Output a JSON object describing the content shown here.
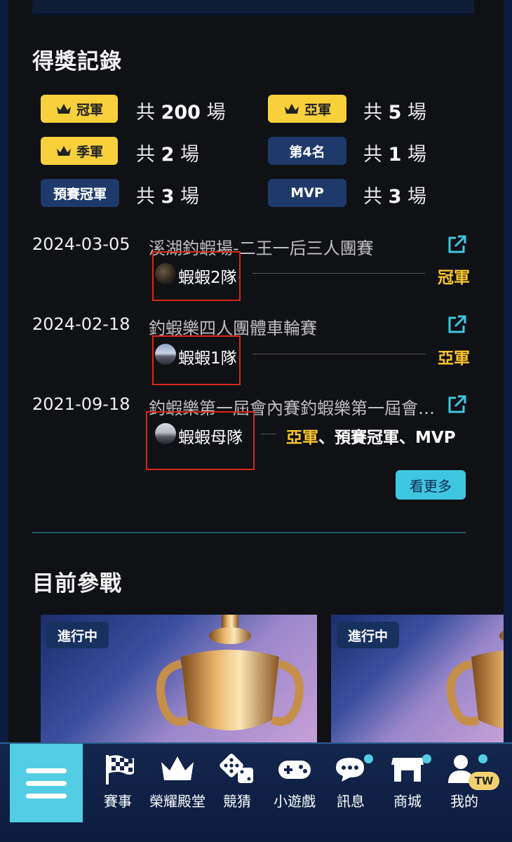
{
  "awards": {
    "title": "得獎記錄",
    "summary": [
      {
        "label": "冠軍",
        "count_prefix": "共",
        "count": "200",
        "count_suffix": "場"
      },
      {
        "label": "亞軍",
        "count_prefix": "共",
        "count": "5",
        "count_suffix": "場"
      },
      {
        "label": "季軍",
        "count_prefix": "共",
        "count": "2",
        "count_suffix": "場"
      },
      {
        "label": "第4名",
        "count_prefix": "共",
        "count": "1",
        "count_suffix": "場"
      },
      {
        "label": "預賽冠軍",
        "count_prefix": "共",
        "count": "3",
        "count_suffix": "場"
      },
      {
        "label": "MVP",
        "count_prefix": "共",
        "count": "3",
        "count_suffix": "場"
      }
    ],
    "records": [
      {
        "date": "2024-03-05",
        "name": "溪湖釣蝦場-二王一后三人團賽",
        "team": "蝦蝦2隊",
        "result": "冠軍"
      },
      {
        "date": "2024-02-18",
        "name": "釣蝦樂四人團體車輪賽",
        "team": "蝦蝦1隊",
        "result": "亞軍"
      },
      {
        "date": "2021-09-18",
        "name": "釣蝦樂第一屆會內賽釣蝦樂第一屆會內賽",
        "team": "蝦蝦母隊",
        "result_a": "亞軍",
        "result_sep1": "、",
        "result_b": "預賽冠軍",
        "result_sep2": "、",
        "result_c": "MVP"
      }
    ],
    "more_label": "看更多"
  },
  "participating": {
    "title": "目前參戰",
    "cards": [
      {
        "status": "進行中"
      },
      {
        "status": "進行中"
      }
    ]
  },
  "nav": {
    "items": [
      {
        "label": "賽事",
        "icon": "checkered-flag-icon"
      },
      {
        "label": "榮耀殿堂",
        "icon": "crown-icon"
      },
      {
        "label": "競猜",
        "icon": "dice-icon"
      },
      {
        "label": "小遊戲",
        "icon": "gamepad-icon"
      },
      {
        "label": "訊息",
        "icon": "chat-icon"
      },
      {
        "label": "商城",
        "icon": "store-icon"
      },
      {
        "label": "我的",
        "icon": "user-icon"
      }
    ],
    "region_badge": "TW"
  },
  "colors": {
    "gold": "#f7d03c",
    "navy": "#1d3a6b",
    "accent": "#53cde3",
    "result": "#f7c52e"
  }
}
